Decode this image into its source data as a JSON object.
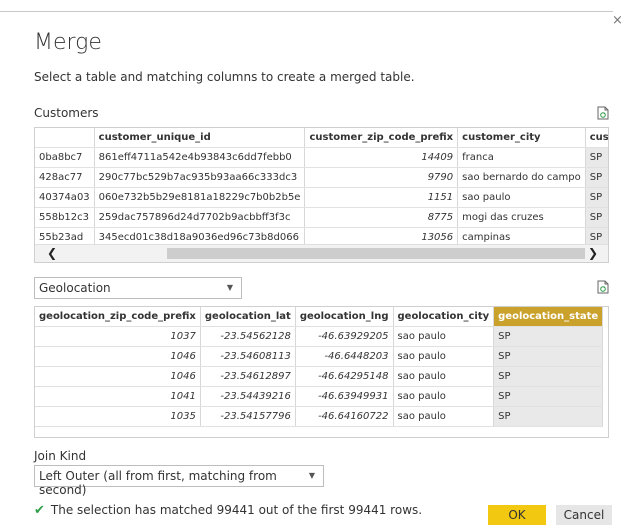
{
  "dialog": {
    "title": "Merge",
    "subtitle": "Select a table and matching columns to create a merged table.",
    "close_glyph": "×"
  },
  "first_table": {
    "label": "Customers",
    "columns": [
      "",
      "customer_unique_id",
      "customer_zip_code_prefix",
      "customer_city",
      "customer_state"
    ],
    "rows": [
      [
        "0ba8bc7",
        "861eff4711a542e4b93843c6dd7febb0",
        "14409",
        "franca",
        "SP"
      ],
      [
        "428ac77",
        "290c77bc529b7ac935b93aa66c333dc3",
        "9790",
        "sao bernardo do campo",
        "SP"
      ],
      [
        "40374a03",
        "060e732b5b29e8181a18229c7b0b2b5e",
        "1151",
        "sao paulo",
        "SP"
      ],
      [
        "558b12c3",
        "259dac757896d24d7702b9acbbff3f3c",
        "8775",
        "mogi das cruzes",
        "SP"
      ],
      [
        "55b23ad",
        "345ecd01c38d18a9036ed96c73b8d066",
        "13056",
        "campinas",
        "SP"
      ]
    ],
    "scroll_left": "❮",
    "scroll_right": "❯"
  },
  "second_table": {
    "selected": "Geolocation",
    "columns": [
      "geolocation_zip_code_prefix",
      "geolocation_lat",
      "geolocation_lng",
      "geolocation_city",
      "geolocation_state"
    ],
    "rows": [
      [
        "1037",
        "-23.54562128",
        "-46.63929205",
        "sao paulo",
        "SP"
      ],
      [
        "1046",
        "-23.54608113",
        "-46.6448203",
        "sao paulo",
        "SP"
      ],
      [
        "1046",
        "-23.54612897",
        "-46.64295148",
        "sao paulo",
        "SP"
      ],
      [
        "1041",
        "-23.54439216",
        "-46.63949931",
        "sao paulo",
        "SP"
      ],
      [
        "1035",
        "-23.54157796",
        "-46.64160722",
        "sao paulo",
        "SP"
      ]
    ]
  },
  "join": {
    "label": "Join Kind",
    "value": "Left Outer (all from first, matching from second)"
  },
  "status": {
    "text": "The selection has matched 99441 out of the first 99441 rows."
  },
  "buttons": {
    "ok": "OK",
    "cancel": "Cancel"
  },
  "colors": {
    "accent": "#f2c811",
    "selected_column": "#c9a12b",
    "check": "#2e9e4a"
  },
  "icons": [
    "close-icon",
    "refresh-file-icon",
    "chevron-down-icon",
    "checkmark-icon",
    "scroll-left-icon",
    "scroll-right-icon"
  ]
}
